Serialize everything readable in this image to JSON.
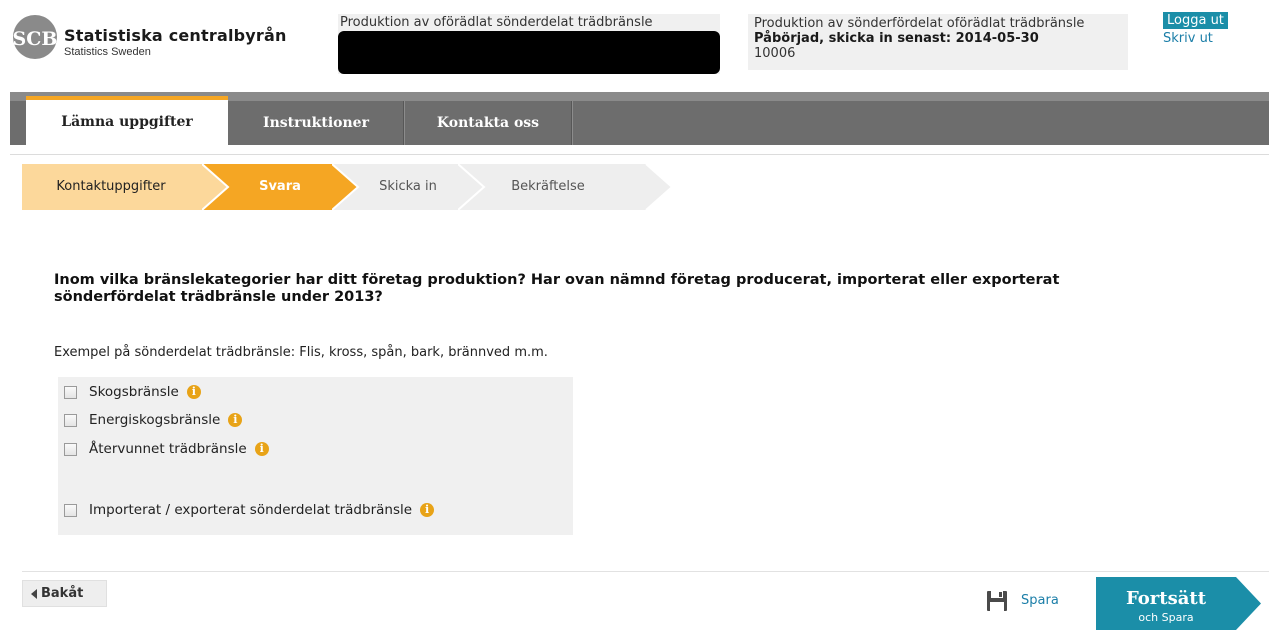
{
  "header": {
    "logo_text": "SCB",
    "brand_name": "Statistiska centralbyrån",
    "brand_sub": "Statistics Sweden",
    "survey_title": "Produktion av oförädlat sönderdelat trädbränsle",
    "status_line1": "Produktion av sönderfördelat oförädlat trädbränsle",
    "status_line2": "Påbörjad, skicka in senast: 2014-05-30",
    "status_line3": "10006",
    "logout_label": "Logga ut",
    "print_label": "Skriv ut"
  },
  "nav": {
    "tabs": [
      {
        "label": "Lämna uppgifter",
        "active": true
      },
      {
        "label": "Instruktioner",
        "active": false
      },
      {
        "label": "Kontakta oss",
        "active": false
      }
    ]
  },
  "steps": [
    {
      "label": "Kontaktuppgifter",
      "state": "done"
    },
    {
      "label": "Svara",
      "state": "current"
    },
    {
      "label": "Skicka in",
      "state": "todo"
    },
    {
      "label": "Bekräftelse",
      "state": "todo"
    }
  ],
  "colors": {
    "step_done": "#fcd89b",
    "step_current": "#f5a623",
    "step_todo": "#eeeeee",
    "accent": "#1b8ea8",
    "info": "#e8a317"
  },
  "question": {
    "text": "Inom vilka bränslekategorier har ditt företag produktion? Har ovan nämnd företag producerat, importerat eller exporterat\nsönderfördelat trädbränsle under 2013?",
    "example": "Exempel på sönderdelat trädbränsle: Flis, kross, spån, bark, brännved m.m."
  },
  "options": [
    {
      "label": "Skogsbränsle",
      "checked": false
    },
    {
      "label": "Energiskogsbränsle",
      "checked": false
    },
    {
      "label": "Återvunnet trädbränsle",
      "checked": false
    },
    {
      "label": "Importerat / exporterat sönderdelat trädbränsle",
      "checked": false
    }
  ],
  "footer": {
    "back_label": "Bakåt",
    "save_label": "Spara",
    "continue_label": "Fortsätt",
    "continue_sub": "och Spara"
  }
}
